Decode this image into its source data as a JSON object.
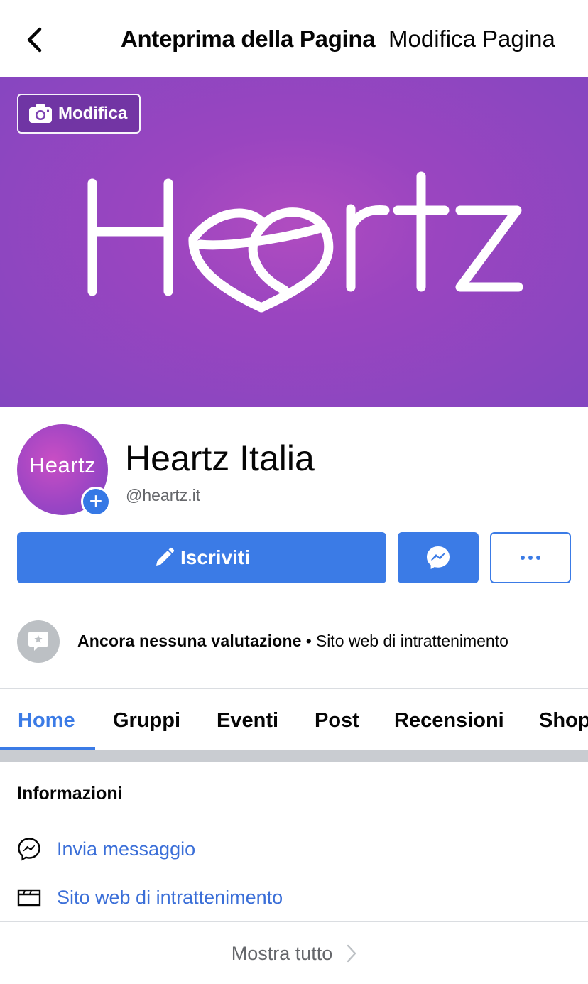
{
  "header": {
    "back_icon": "chevron-left-icon",
    "title": "Anteprima della Pagina",
    "edit_label": "Modifica Pagina"
  },
  "cover": {
    "edit_label": "Modifica",
    "edit_icon": "camera-icon",
    "logo_text": "Heartz",
    "gradient_colors": [
      "#b04cc0",
      "#8446c0"
    ]
  },
  "profile": {
    "avatar_text": "Heartz",
    "name": "Heartz Italia",
    "handle": "@heartz.it"
  },
  "actions": {
    "primary_label": "Iscriviti",
    "primary_icon": "pencil-icon",
    "messenger_icon": "messenger-icon",
    "more_icon": "more-dots-icon",
    "accent_color": "#3b7be6"
  },
  "rating": {
    "status": "Ancora nessuna valutazione",
    "separator": "•",
    "category": "Sito web di intrattenimento"
  },
  "tabs": [
    {
      "label": "Home",
      "active": true
    },
    {
      "label": "Gruppi"
    },
    {
      "label": "Eventi"
    },
    {
      "label": "Post"
    },
    {
      "label": "Recensioni"
    },
    {
      "label": "Shop"
    }
  ],
  "info": {
    "title": "Informazioni",
    "items": [
      {
        "icon": "messenger-icon",
        "label": "Invia messaggio"
      },
      {
        "icon": "clapperboard-icon",
        "label": "Sito web di intrattenimento"
      }
    ],
    "show_all_label": "Mostra tutto"
  }
}
